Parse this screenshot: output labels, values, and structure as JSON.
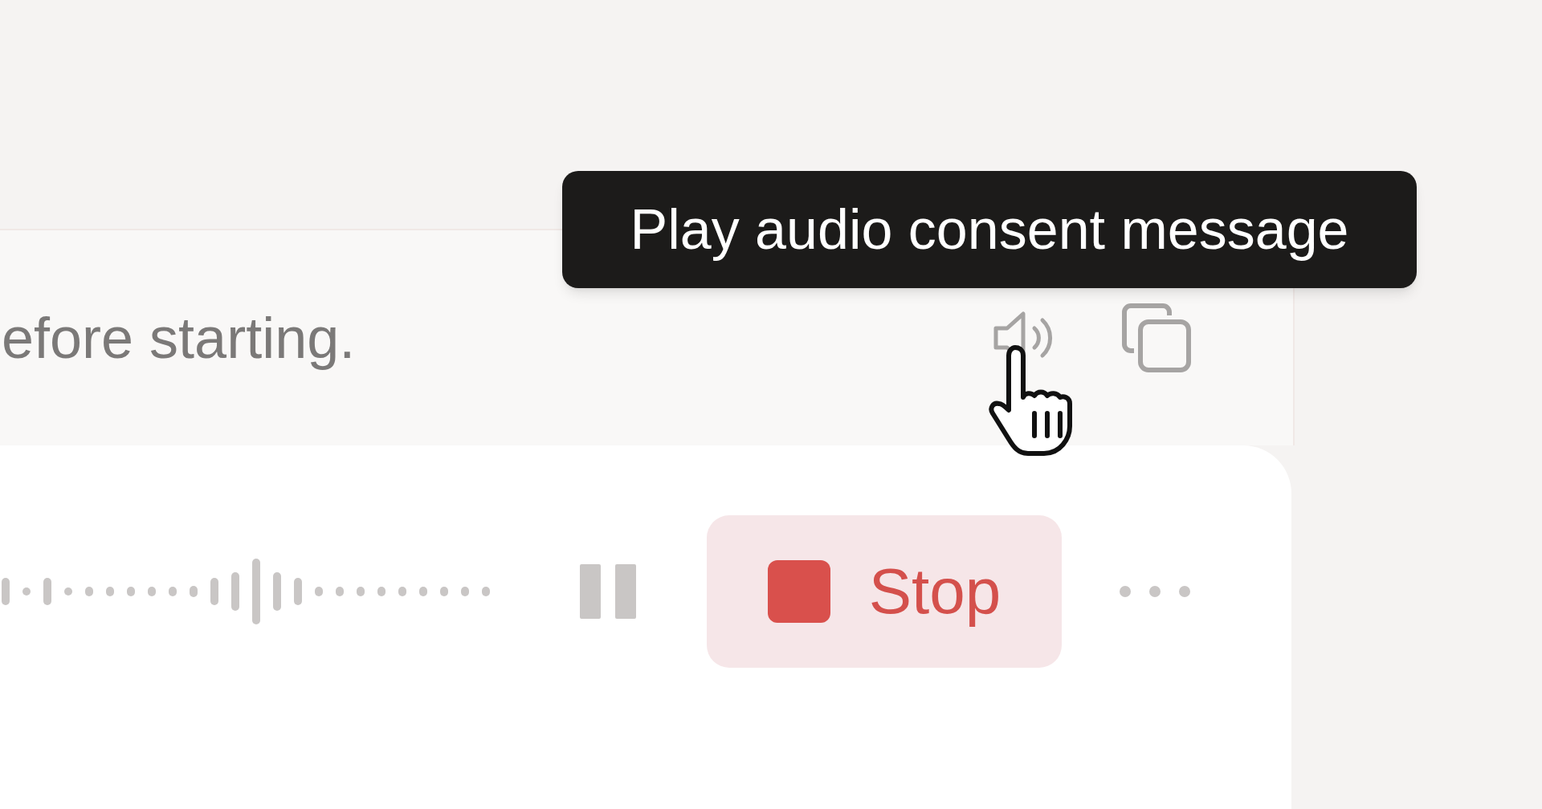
{
  "message": {
    "text": "efore starting."
  },
  "tooltip": {
    "text": "Play audio consent message"
  },
  "recorder": {
    "stop_button": {
      "label": "Stop"
    }
  }
}
